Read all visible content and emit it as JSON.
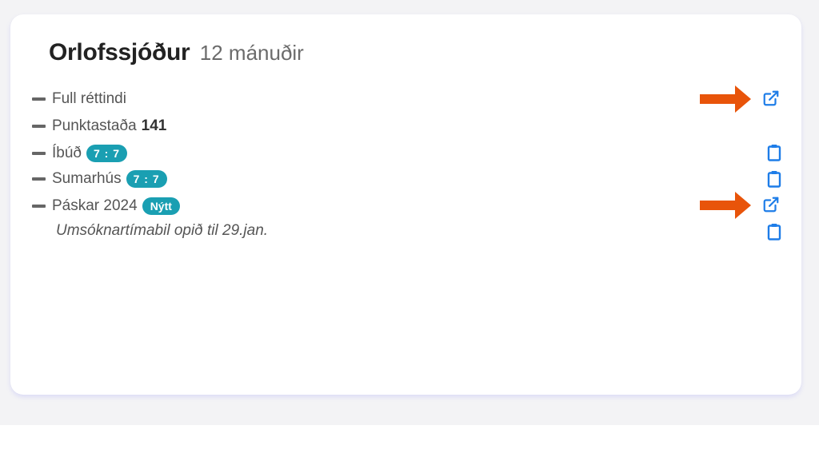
{
  "card": {
    "title": "Orlofssjóður",
    "subtitle": "12 mánuðir"
  },
  "items": [
    {
      "label": "Full réttindi",
      "action_icon": "external-link-icon"
    },
    {
      "label": "Punktastaða",
      "value": "141"
    },
    {
      "label": "Íbúð",
      "badge": "7 : 7",
      "action_icon": "clipboard-icon"
    },
    {
      "label": "Sumarhús",
      "badge": "7 : 7",
      "action_icon": "clipboard-icon"
    },
    {
      "label": "Páskar 2024",
      "badge": "Nýtt",
      "action_icon": "external-link-icon"
    }
  ],
  "note": {
    "text": "Umsóknartímabil opið til 29.jan.",
    "action_icon": "clipboard-icon"
  },
  "annotations": {
    "arrow_color": "#e8540a"
  },
  "colors": {
    "icon_blue": "#1e7de8",
    "badge_teal": "#1a9fb2"
  }
}
